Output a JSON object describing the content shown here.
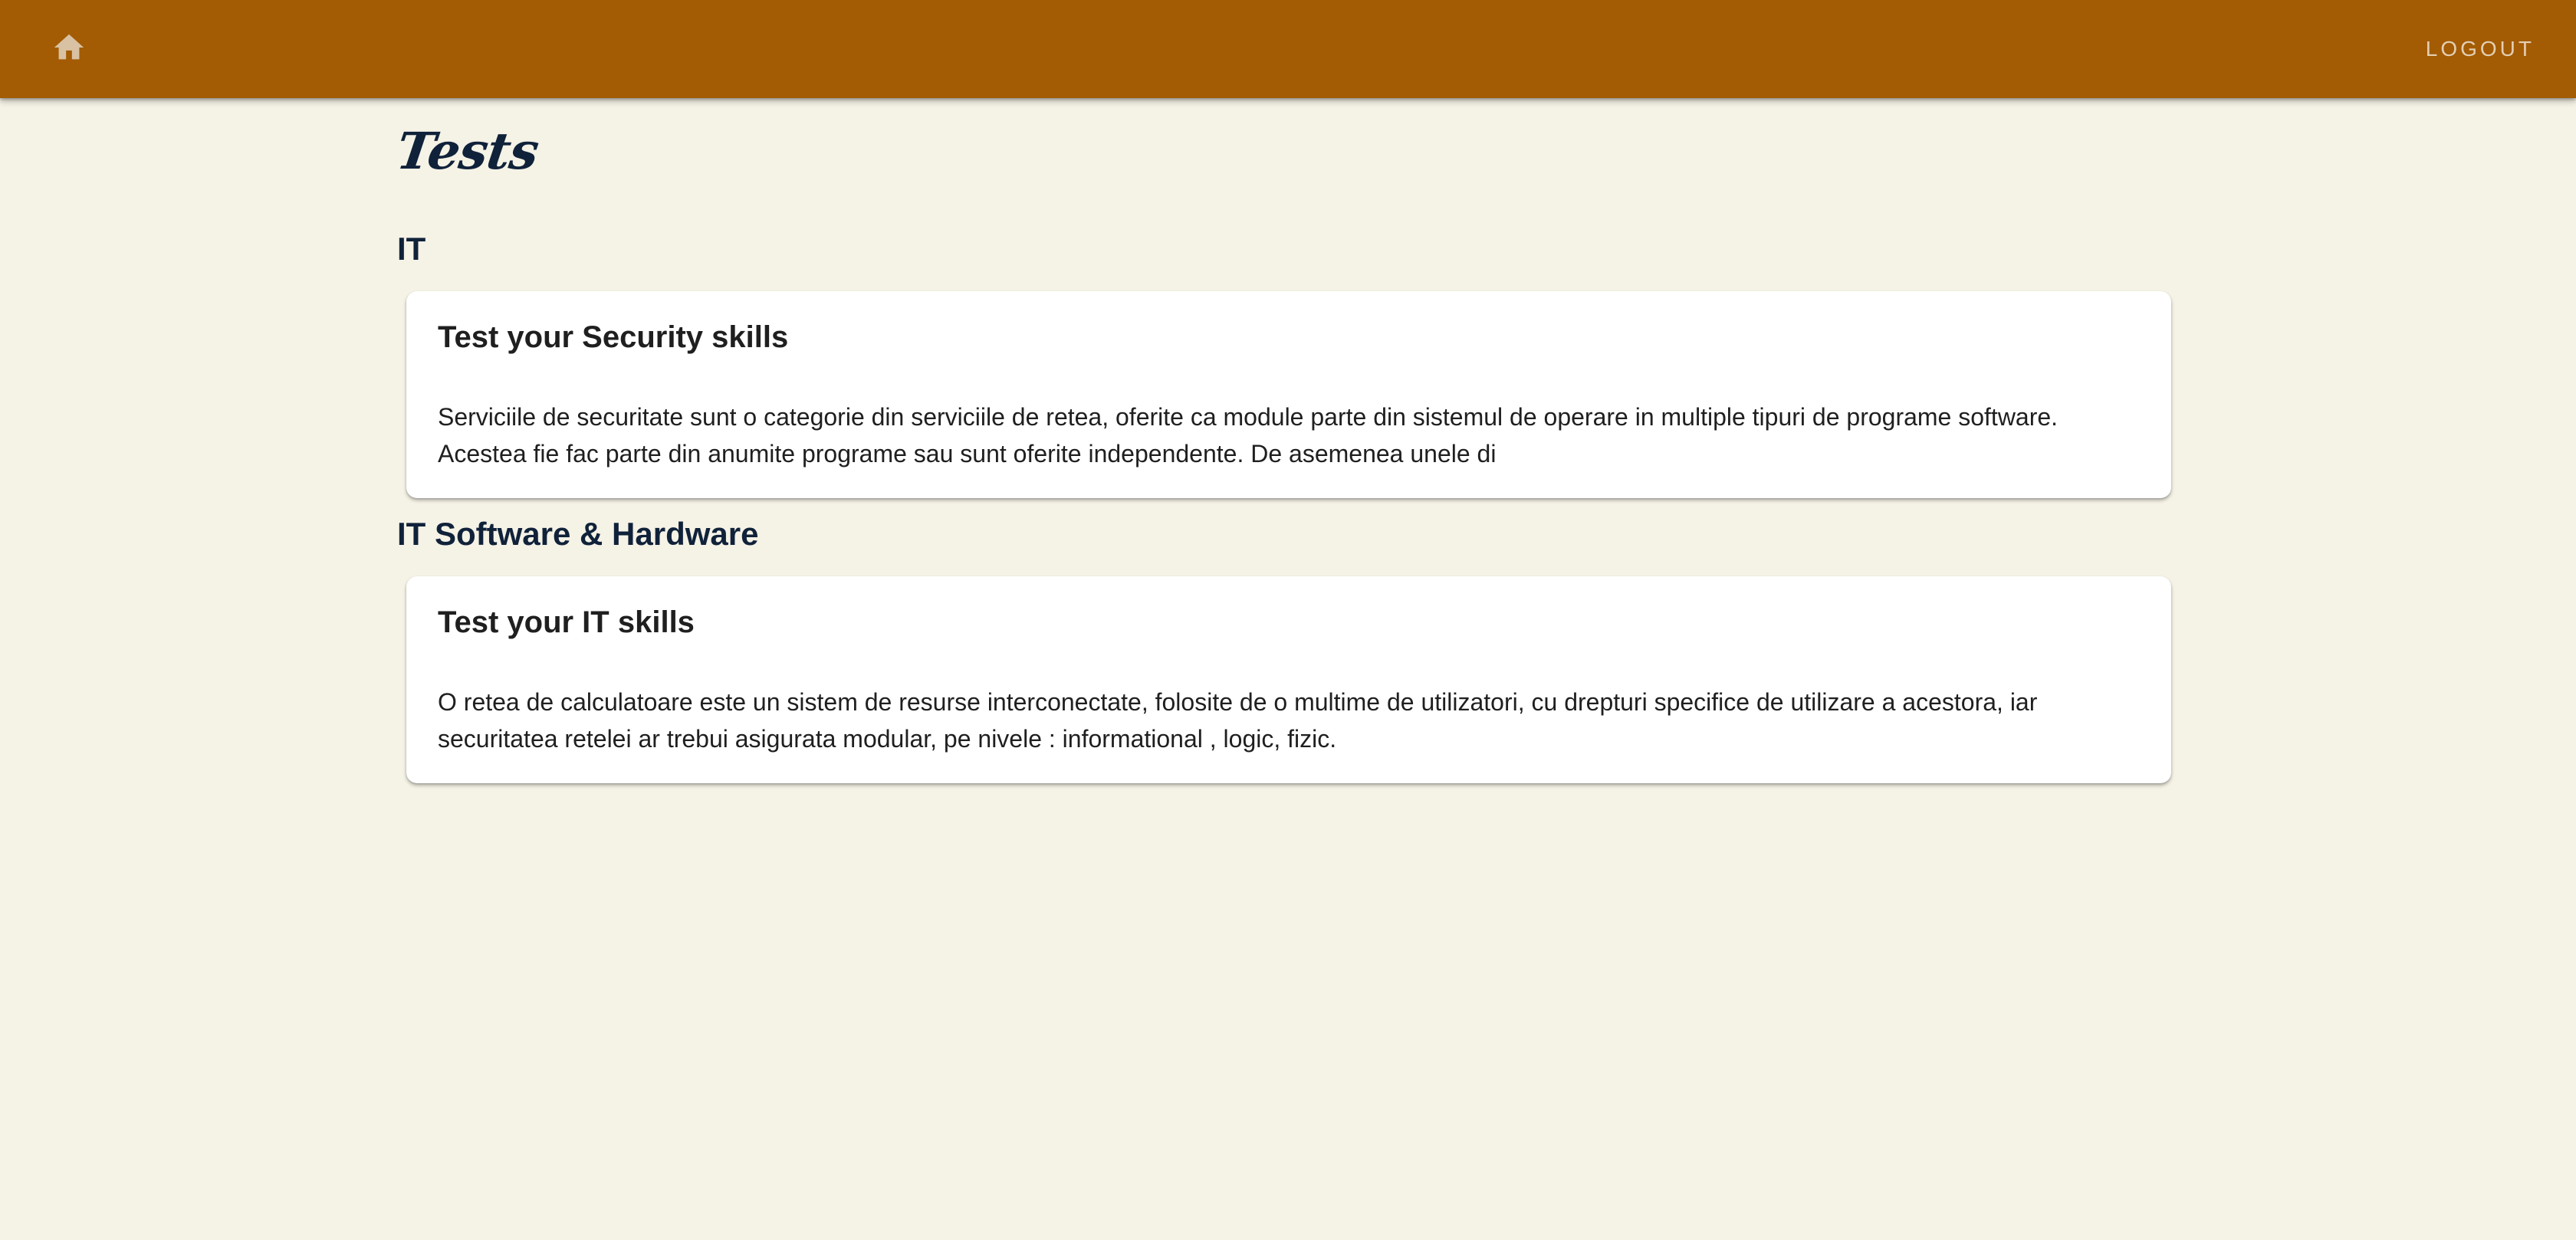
{
  "header": {
    "home_icon": "home-icon",
    "logout_label": "LOGOUT",
    "background_color": "#a35b04"
  },
  "page": {
    "title": "Tests",
    "background_color": "#f5f2e6"
  },
  "sections": [
    {
      "name": "IT",
      "tests": [
        {
          "title": "Test your Security skills",
          "description": "Serviciile de securitate sunt o categorie din serviciile de retea, oferite ca module parte din sistemul de operare in multiple tipuri de programe software. Acestea fie fac parte din anumite programe sau sunt oferite independente. De asemenea unele di"
        }
      ]
    },
    {
      "name": "IT Software & Hardware",
      "tests": [
        {
          "title": "Test your IT skills",
          "description": "O retea de calculatoare este un sistem de resurse interconectate, folosite de o multime de utilizatori, cu drepturi specifice de utilizare a acestora, iar securitatea retelei ar trebui asigurata modular, pe nivele : informational , logic, fizic."
        }
      ]
    }
  ]
}
